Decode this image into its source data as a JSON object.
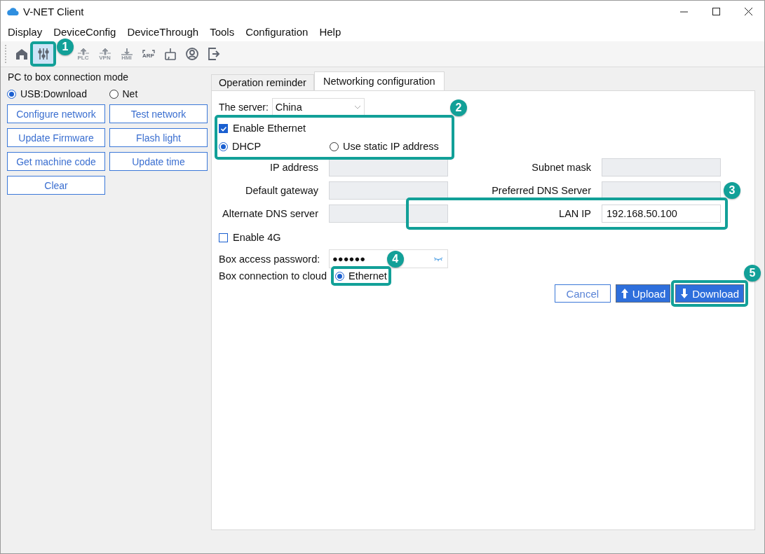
{
  "window": {
    "title": "V-NET Client"
  },
  "menu": [
    {
      "label": "Display"
    },
    {
      "label": "DeviceConfig"
    },
    {
      "label": "DeviceThrough"
    },
    {
      "label": "Tools"
    },
    {
      "label": "Configuration"
    },
    {
      "label": "Help"
    }
  ],
  "toolbar": [
    {
      "kind": "home",
      "selected": false,
      "disabled": false
    },
    {
      "kind": "sliders",
      "selected": true,
      "disabled": false,
      "callout": "1"
    },
    {
      "kind": "up",
      "label": "PLC",
      "selected": false,
      "disabled": true
    },
    {
      "kind": "up",
      "label": "VPN",
      "selected": false,
      "disabled": true
    },
    {
      "kind": "down",
      "label": "HMI",
      "selected": false,
      "disabled": true
    },
    {
      "kind": "arp",
      "label": "ARP",
      "selected": false,
      "disabled": false
    },
    {
      "kind": "network",
      "selected": false,
      "disabled": false
    },
    {
      "kind": "user",
      "selected": false,
      "disabled": false
    },
    {
      "kind": "logout",
      "selected": false,
      "disabled": false
    }
  ],
  "left_panel": {
    "title": "PC to box connection mode",
    "modes": [
      {
        "label": "USB:Download",
        "selected": true
      },
      {
        "label": "Net",
        "selected": false
      }
    ],
    "buttons": [
      "Configure network",
      "Test network",
      "Update Firmware",
      "Flash light",
      "Get machine code",
      "Update time",
      "Clear"
    ]
  },
  "tabs": [
    {
      "label": "Operation reminder",
      "selected": false
    },
    {
      "label": "Networking configuration",
      "selected": true
    }
  ],
  "form": {
    "server": {
      "label": "The server:",
      "value": "China"
    },
    "ethernet_group": {
      "callout": "2",
      "enable": {
        "label": "Enable Ethernet",
        "checked": true
      },
      "ip_modes": [
        {
          "label": "DHCP",
          "selected": true
        },
        {
          "label": "Use static IP address",
          "selected": false
        }
      ]
    },
    "fields": [
      {
        "label": "IP address",
        "disabled": true
      },
      {
        "label": "Subnet mask",
        "disabled": true
      },
      {
        "label": "Default gateway",
        "disabled": true
      },
      {
        "label": "Preferred DNS Server",
        "disabled": true
      },
      {
        "label": "Alternate DNS server",
        "disabled": true
      },
      {
        "label": "LAN IP",
        "value": "192.168.50.100",
        "disabled": false,
        "callout": "3"
      }
    ],
    "enable_4g": {
      "label": "Enable 4G",
      "checked": false
    },
    "password": {
      "label": "Box access password:",
      "value": "●●●●●●"
    },
    "cloud": {
      "label": "Box connection to cloud",
      "callout": "4",
      "options": [
        {
          "label": "Ethernet",
          "selected": true
        }
      ]
    },
    "actions": [
      {
        "kind": "cancel",
        "label": "Cancel"
      },
      {
        "kind": "upload",
        "label": "Upload"
      },
      {
        "kind": "download",
        "label": "Download",
        "callout": "5"
      }
    ]
  }
}
